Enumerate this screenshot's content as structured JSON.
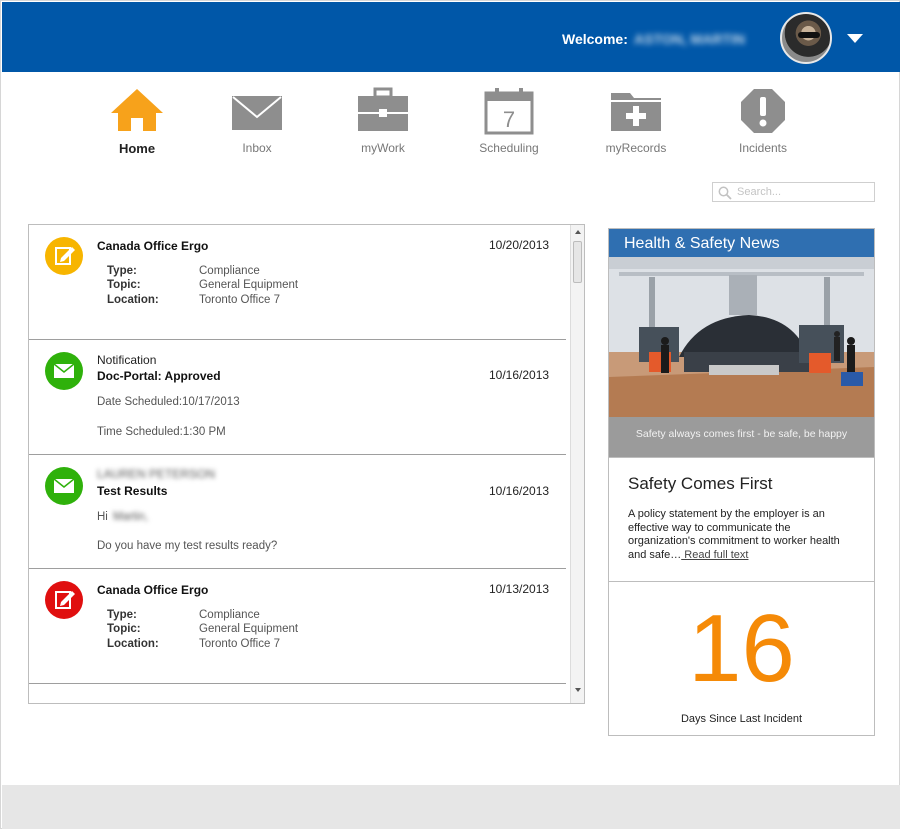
{
  "header": {
    "welcome_label": "Welcome:",
    "user_name": "ASTON, MARTIN"
  },
  "nav": {
    "items": [
      {
        "label": "Home",
        "icon": "home-icon",
        "active": true
      },
      {
        "label": "Inbox",
        "icon": "envelope-icon"
      },
      {
        "label": "myWork",
        "icon": "briefcase-icon"
      },
      {
        "label": "Scheduling",
        "icon": "calendar-icon",
        "calendar_day": "7"
      },
      {
        "label": "myRecords",
        "icon": "folder-plus-icon"
      },
      {
        "label": "Incidents",
        "icon": "alert-octagon-icon"
      }
    ]
  },
  "search": {
    "placeholder": "Search..."
  },
  "feed": {
    "items": [
      {
        "title": "Canada Office Ergo",
        "date": "10/20/2013",
        "badge": "edit-icon",
        "badge_color": "#f7b500",
        "fields": [
          {
            "label": "Type:",
            "value": "Compliance"
          },
          {
            "label": "Topic:",
            "value": "General Equipment"
          },
          {
            "label": "Location:",
            "value": "Toronto Office 7"
          }
        ]
      },
      {
        "kind": "Notification",
        "title": "Doc-Portal: Approved",
        "date": "10/16/2013",
        "badge": "envelope-icon",
        "badge_color": "#2fb10b",
        "line1": "Date Scheduled:10/17/2013",
        "line2": "Time Scheduled:1:30 PM"
      },
      {
        "sender": "LAUREN PETERSON",
        "title": "Test Results",
        "date": "10/16/2013",
        "badge": "envelope-icon",
        "badge_color": "#2fb10b",
        "greeting": "Hi",
        "greeting_name": "Martin,",
        "message": "Do you have my test results ready?"
      },
      {
        "title": "Canada Office Ergo",
        "date": "10/13/2013",
        "badge": "edit-icon",
        "badge_color": "#e00f0f",
        "fields": [
          {
            "label": "Type:",
            "value": "Compliance"
          },
          {
            "label": "Topic:",
            "value": "General Equipment"
          },
          {
            "label": "Location:",
            "value": "Toronto Office 7"
          }
        ]
      }
    ]
  },
  "news": {
    "heading": "Health & Safety News",
    "caption": "Safety always comes first - be safe, be happy",
    "title": "Safety Comes First",
    "body": "A policy statement by the employer is an effective way to communicate the organization's commitment to worker health and safe…",
    "read_more": " Read full text"
  },
  "incidents": {
    "days_since": "16",
    "label": "Days Since Last Incident"
  },
  "colors": {
    "header_bg": "#0057a8",
    "news_header_bg": "#2f6fb1",
    "home_icon": "#f7a21b",
    "nav_icon": "#8e8e8e",
    "counter": "#f58a07"
  }
}
